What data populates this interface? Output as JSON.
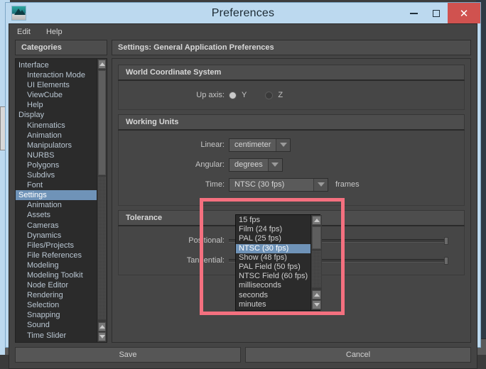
{
  "window": {
    "title": "Preferences",
    "icon": "maya-app-icon",
    "controls": {
      "minimize": "minimize-icon",
      "maximize": "maximize-icon",
      "close": "✕"
    }
  },
  "menubar": {
    "items": [
      {
        "label": "Edit"
      },
      {
        "label": "Help"
      }
    ]
  },
  "categories": {
    "header": "Categories",
    "items": [
      {
        "label": "Interface",
        "level": 0,
        "selected": false
      },
      {
        "label": "Interaction Mode",
        "level": 1,
        "selected": false
      },
      {
        "label": "UI Elements",
        "level": 1,
        "selected": false
      },
      {
        "label": "ViewCube",
        "level": 1,
        "selected": false
      },
      {
        "label": "Help",
        "level": 1,
        "selected": false
      },
      {
        "label": "Display",
        "level": 0,
        "selected": false
      },
      {
        "label": "Kinematics",
        "level": 1,
        "selected": false
      },
      {
        "label": "Animation",
        "level": 1,
        "selected": false
      },
      {
        "label": "Manipulators",
        "level": 1,
        "selected": false
      },
      {
        "label": "NURBS",
        "level": 1,
        "selected": false
      },
      {
        "label": "Polygons",
        "level": 1,
        "selected": false
      },
      {
        "label": "Subdivs",
        "level": 1,
        "selected": false
      },
      {
        "label": "Font",
        "level": 1,
        "selected": false
      },
      {
        "label": "Settings",
        "level": 0,
        "selected": true
      },
      {
        "label": "Animation",
        "level": 1,
        "selected": false
      },
      {
        "label": "Assets",
        "level": 1,
        "selected": false
      },
      {
        "label": "Cameras",
        "level": 1,
        "selected": false
      },
      {
        "label": "Dynamics",
        "level": 1,
        "selected": false
      },
      {
        "label": "Files/Projects",
        "level": 1,
        "selected": false
      },
      {
        "label": "File References",
        "level": 1,
        "selected": false
      },
      {
        "label": "Modeling",
        "level": 1,
        "selected": false
      },
      {
        "label": "Modeling Toolkit",
        "level": 1,
        "selected": false
      },
      {
        "label": "Node Editor",
        "level": 1,
        "selected": false
      },
      {
        "label": "Rendering",
        "level": 1,
        "selected": false
      },
      {
        "label": "Selection",
        "level": 1,
        "selected": false
      },
      {
        "label": "Snapping",
        "level": 1,
        "selected": false
      },
      {
        "label": "Sound",
        "level": 1,
        "selected": false
      },
      {
        "label": "Time Slider",
        "level": 1,
        "selected": false
      }
    ]
  },
  "settings": {
    "header": "Settings: General Application Preferences",
    "groups": [
      {
        "title": "World Coordinate System",
        "rows": [
          {
            "label": "Up axis:",
            "type": "radio",
            "options": [
              {
                "label": "Y",
                "checked": true
              },
              {
                "label": "Z",
                "checked": false
              }
            ]
          }
        ]
      },
      {
        "title": "Working Units",
        "rows": [
          {
            "label": "Linear:",
            "type": "combo",
            "value": "centimeter"
          },
          {
            "label": "Angular:",
            "type": "combo",
            "value": "degrees"
          },
          {
            "label": "Time:",
            "type": "combo",
            "value": "NTSC (30 fps)",
            "note": "frames"
          }
        ]
      },
      {
        "title": "Tolerance",
        "rows": [
          {
            "label": "Positional:",
            "type": "slider"
          },
          {
            "label": "Tangential:",
            "type": "slider"
          }
        ]
      }
    ]
  },
  "dropdown": {
    "open": true,
    "options": [
      {
        "label": "15 fps",
        "selected": false
      },
      {
        "label": "Film (24 fps)",
        "selected": false
      },
      {
        "label": "PAL (25 fps)",
        "selected": false
      },
      {
        "label": "NTSC (30 fps)",
        "selected": true
      },
      {
        "label": "Show (48 fps)",
        "selected": false
      },
      {
        "label": "PAL Field (50 fps)",
        "selected": false
      },
      {
        "label": "NTSC Field (60 fps)",
        "selected": false
      },
      {
        "label": "milliseconds",
        "selected": false
      },
      {
        "label": "seconds",
        "selected": false
      },
      {
        "label": "minutes",
        "selected": false
      }
    ]
  },
  "footer": {
    "save_label": "Save",
    "cancel_label": "Cancel"
  },
  "colors": {
    "title_bar": "#bcd9ef",
    "close_button": "#d0524f",
    "selection": "#6f93b8",
    "annotation": "#f4707f",
    "panel": "#464646"
  }
}
